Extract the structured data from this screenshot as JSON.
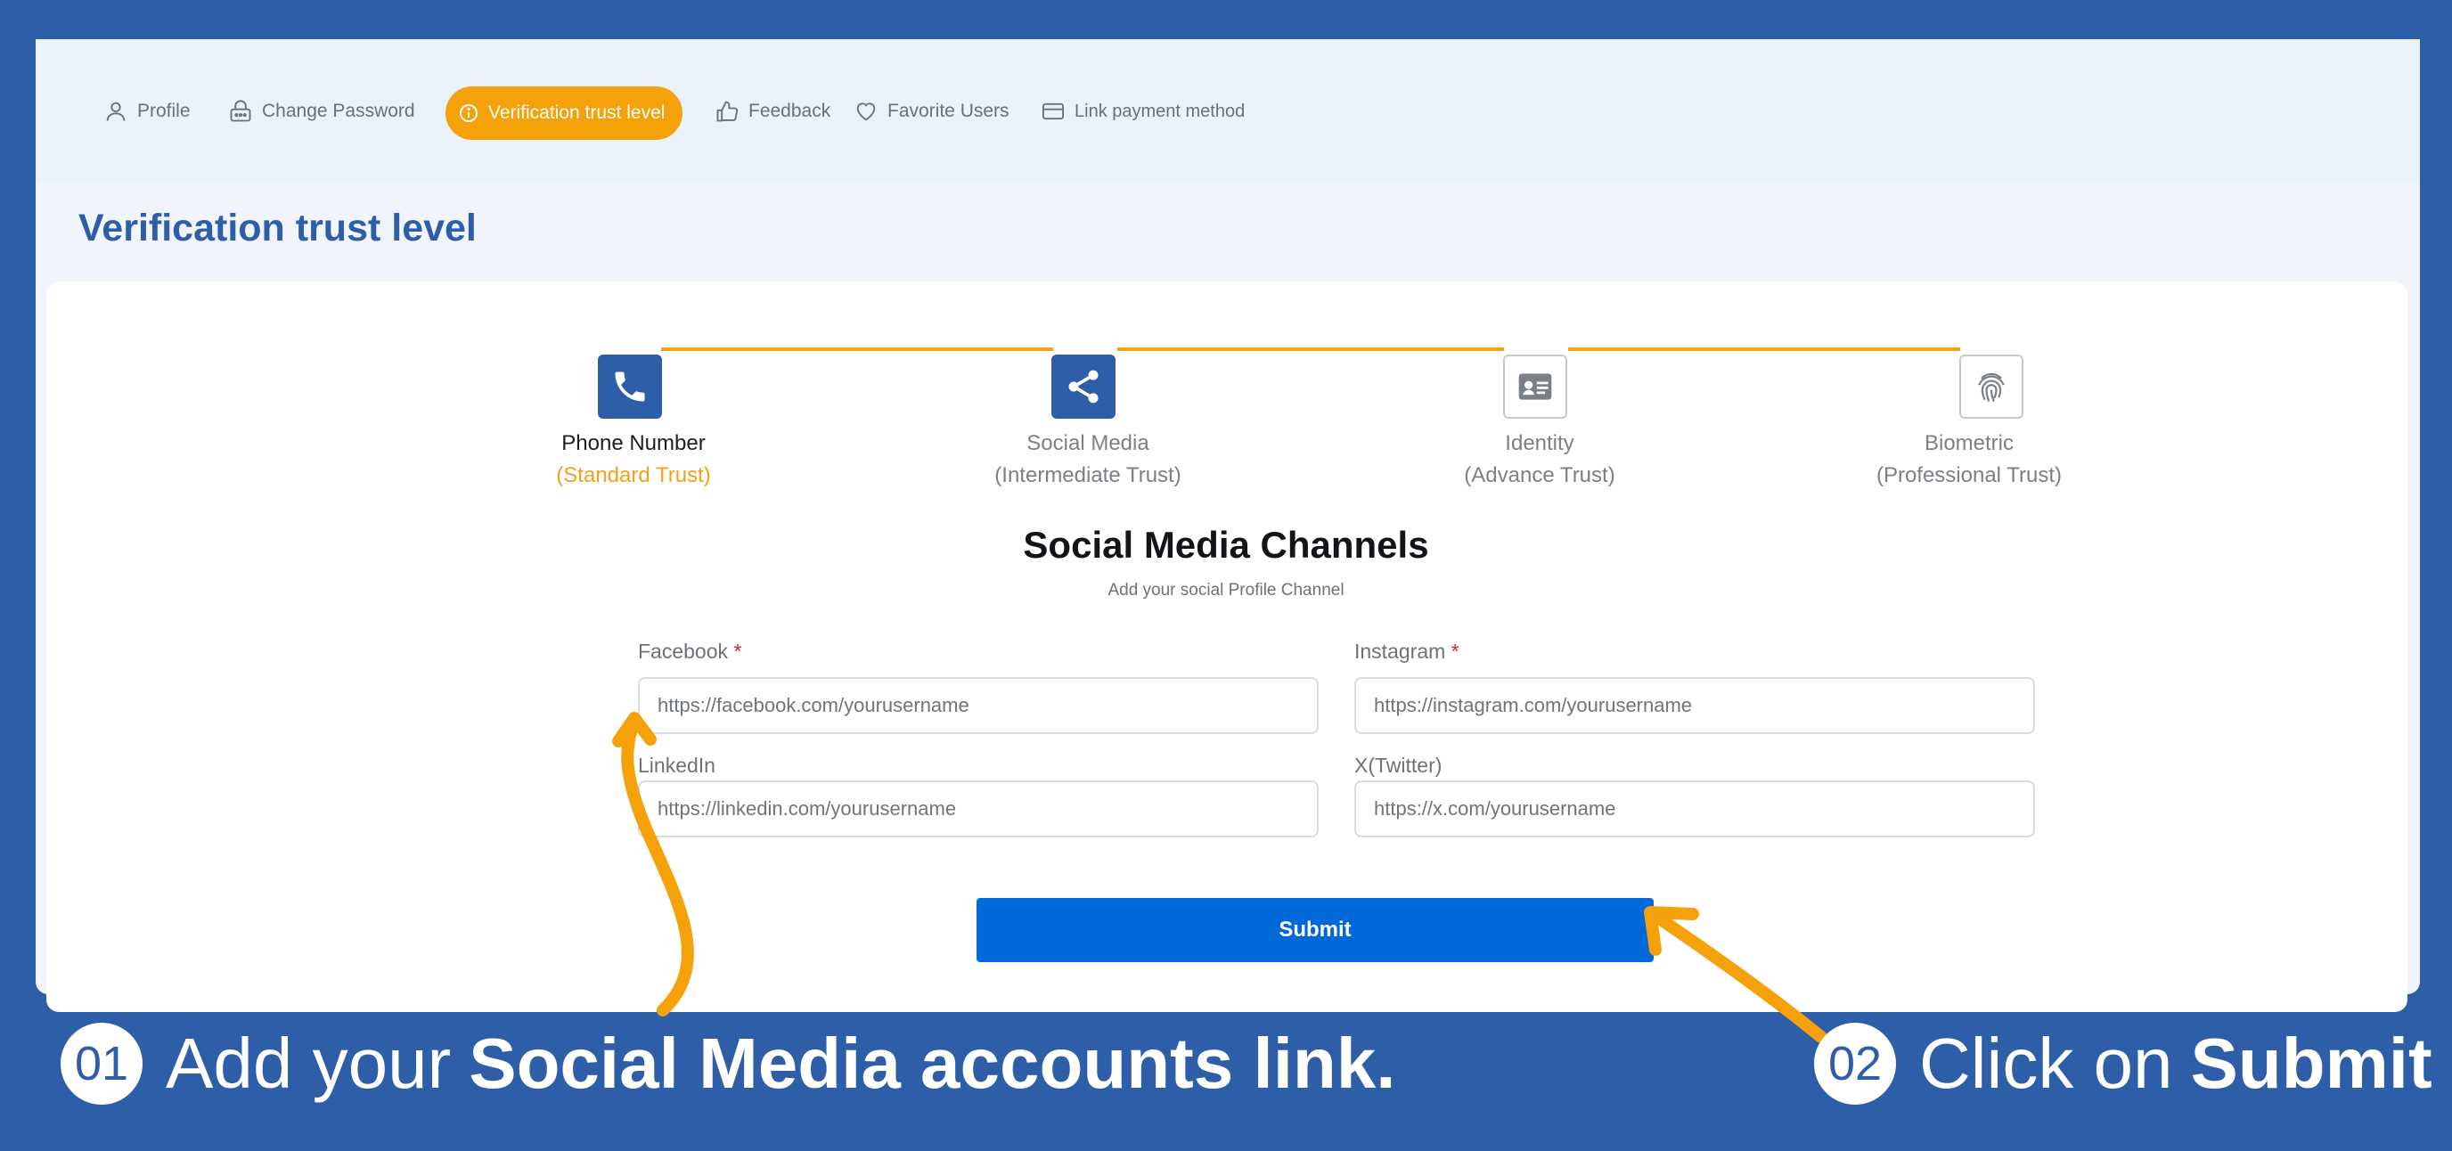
{
  "nav": {
    "items": [
      {
        "label": "Profile",
        "icon": "user-icon"
      },
      {
        "label": "Change Password",
        "icon": "password-icon"
      },
      {
        "label": "Verification trust level",
        "icon": "info-icon",
        "active": true
      },
      {
        "label": "Feedback",
        "icon": "thumbs-up-icon"
      },
      {
        "label": "Favorite Users",
        "icon": "heart-icon"
      },
      {
        "label": "Link payment method",
        "icon": "credit-card-icon"
      }
    ]
  },
  "page_title": "Verification trust level",
  "steps": [
    {
      "title": "Phone Number",
      "subtitle": "(Standard Trust)",
      "icon": "phone-icon",
      "state": "done"
    },
    {
      "title": "Social Media",
      "subtitle": "(Intermediate Trust)",
      "icon": "share-icon",
      "state": "done"
    },
    {
      "title": "Identity",
      "subtitle": "(Advance Trust)",
      "icon": "id-card-icon",
      "state": "todo"
    },
    {
      "title": "Biometric",
      "subtitle": "(Professional Trust)",
      "icon": "fingerprint-icon",
      "state": "todo"
    }
  ],
  "form": {
    "title": "Social Media Channels",
    "subtitle": "Add your social Profile Channel",
    "required_mark": "*",
    "fields": {
      "facebook": {
        "label": "Facebook",
        "placeholder": "https://facebook.com/yourusername",
        "required": true
      },
      "instagram": {
        "label": "Instagram",
        "placeholder": "https://instagram.com/yourusername",
        "required": true
      },
      "linkedin": {
        "label": "LinkedIn",
        "placeholder": "https://linkedin.com/yourusername",
        "required": false
      },
      "twitter": {
        "label": "X(Twitter)",
        "placeholder": "https://x.com/yourusername",
        "required": false
      }
    },
    "submit_label": "Submit"
  },
  "captions": {
    "step1": {
      "number": "01",
      "text": "Add your",
      "bold": "Social Media accounts link."
    },
    "step2": {
      "number": "02",
      "text": "Click on",
      "bold": "Submit"
    }
  },
  "colors": {
    "brand_blue": "#2f5ea9",
    "accent_orange": "#f4a10a",
    "submit_blue": "#0068d9",
    "required_red": "#d8242c"
  }
}
